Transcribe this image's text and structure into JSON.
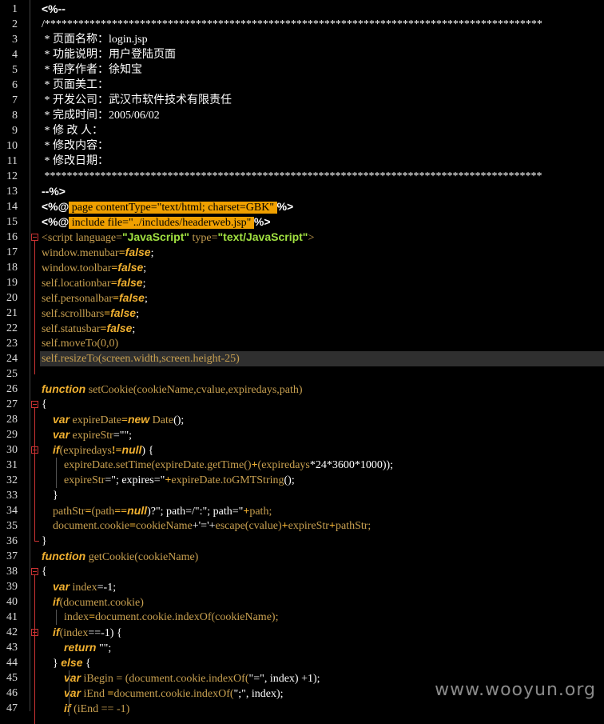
{
  "editor": {
    "lines": [
      [
        {
          "t": "<%--",
          "c": "w"
        }
      ],
      [
        {
          "t": "/*****************************************************************************************",
          "c": "wt"
        }
      ],
      [
        {
          "t": " * 页面名称：login.jsp",
          "c": "wt"
        }
      ],
      [
        {
          "t": " * 功能说明：用户登陆页面",
          "c": "wt"
        }
      ],
      [
        {
          "t": " * 程序作者：徐知宝",
          "c": "wt"
        }
      ],
      [
        {
          "t": " * 页面美工：",
          "c": "wt"
        }
      ],
      [
        {
          "t": " * 开发公司：武汉市软件技术有限责任",
          "c": "wt"
        }
      ],
      [
        {
          "t": " * 完成时间：2005/06/02",
          "c": "wt"
        }
      ],
      [
        {
          "t": " * 修 改 人：",
          "c": "wt"
        }
      ],
      [
        {
          "t": " * 修改内容：",
          "c": "wt"
        }
      ],
      [
        {
          "t": " * 修改日期：",
          "c": "wt"
        }
      ],
      [
        {
          "t": " *****************************************************************************************",
          "c": "wt"
        }
      ],
      [
        {
          "t": "--%>",
          "c": "w"
        }
      ],
      [
        {
          "t": "<%@",
          "c": "w"
        },
        {
          "t": " page contentType=\"text/html; charset=GBK\" ",
          "c": "sel"
        },
        {
          "t": "%>",
          "c": "w"
        }
      ],
      [
        {
          "t": "<%@",
          "c": "w"
        },
        {
          "t": " include file=\"../includes/headerweb.jsp\" ",
          "c": "sel"
        },
        {
          "t": "%>",
          "c": "w"
        }
      ],
      [
        {
          "t": "<script language=",
          "c": "tag"
        },
        {
          "t": "\"JavaScript\"",
          "c": "str"
        },
        {
          "t": " type=",
          "c": "tag"
        },
        {
          "t": "\"text/JavaScript\"",
          "c": "str"
        },
        {
          "t": ">",
          "c": "tag"
        }
      ],
      [
        {
          "t": "window.menubar",
          "c": "id"
        },
        {
          "t": "=",
          "c": "op"
        },
        {
          "t": "false",
          "c": "kw"
        },
        {
          "t": ";",
          "c": "p"
        }
      ],
      [
        {
          "t": "window.toolbar",
          "c": "id"
        },
        {
          "t": "=",
          "c": "op"
        },
        {
          "t": "false",
          "c": "kw"
        },
        {
          "t": ";",
          "c": "p"
        }
      ],
      [
        {
          "t": "self.locationbar",
          "c": "id"
        },
        {
          "t": "=",
          "c": "op"
        },
        {
          "t": "false",
          "c": "kw"
        },
        {
          "t": ";",
          "c": "p"
        }
      ],
      [
        {
          "t": "self.personalbar",
          "c": "id"
        },
        {
          "t": "=",
          "c": "op"
        },
        {
          "t": "false",
          "c": "kw"
        },
        {
          "t": ";",
          "c": "p"
        }
      ],
      [
        {
          "t": "self.scrollbars",
          "c": "id"
        },
        {
          "t": "=",
          "c": "op"
        },
        {
          "t": "false",
          "c": "kw"
        },
        {
          "t": ";",
          "c": "p"
        }
      ],
      [
        {
          "t": "self.statusbar",
          "c": "id"
        },
        {
          "t": "=",
          "c": "op"
        },
        {
          "t": "false",
          "c": "kw"
        },
        {
          "t": ";",
          "c": "p"
        }
      ],
      [
        {
          "t": "self.moveTo(0,0)",
          "c": "id"
        }
      ],
      [
        {
          "t": "self.resizeTo(screen.width,screen.height-25)",
          "c": "id"
        }
      ],
      [],
      [
        {
          "t": "function",
          "c": "kw"
        },
        {
          "t": " setCookie(cookieName,cvalue,expiredays,path)",
          "c": "id"
        }
      ],
      [
        {
          "t": "{",
          "c": "p"
        }
      ],
      [
        {
          "t": "    ",
          "c": "id"
        },
        {
          "t": "var",
          "c": "kw"
        },
        {
          "t": " expireDate",
          "c": "id"
        },
        {
          "t": "=",
          "c": "op"
        },
        {
          "t": "new",
          "c": "kw"
        },
        {
          "t": " Date",
          "c": "id"
        },
        {
          "t": "();",
          "c": "p"
        }
      ],
      [
        {
          "t": "    ",
          "c": "id"
        },
        {
          "t": "var",
          "c": "kw"
        },
        {
          "t": " expireStr",
          "c": "id"
        },
        {
          "t": "=\"\";",
          "c": "p"
        }
      ],
      [
        {
          "t": "    ",
          "c": "id"
        },
        {
          "t": "if",
          "c": "kw"
        },
        {
          "t": "(expiredays",
          "c": "id"
        },
        {
          "t": "!=",
          "c": "op"
        },
        {
          "t": "null",
          "c": "kw"
        },
        {
          "t": ") {",
          "c": "p"
        }
      ],
      [
        {
          "t": "        expireDate.setTime(expireDate.getTime()",
          "c": "id"
        },
        {
          "t": "+",
          "c": "op"
        },
        {
          "t": "(expiredays",
          "c": "id"
        },
        {
          "t": "*24*3600*1000));",
          "c": "p"
        }
      ],
      [
        {
          "t": "        expireStr",
          "c": "id"
        },
        {
          "t": "=\"; expires=\"",
          "c": "p"
        },
        {
          "t": "+",
          "c": "op"
        },
        {
          "t": "expireDate.toGMTString",
          "c": "id"
        },
        {
          "t": "();",
          "c": "p"
        }
      ],
      [
        {
          "t": "    }",
          "c": "p"
        }
      ],
      [
        {
          "t": "    pathStr",
          "c": "id"
        },
        {
          "t": "=",
          "c": "op"
        },
        {
          "t": "(path",
          "c": "id"
        },
        {
          "t": "==",
          "c": "op"
        },
        {
          "t": "null",
          "c": "kw"
        },
        {
          "t": ")?\"; path=/\":\"; path=\"",
          "c": "p"
        },
        {
          "t": "+",
          "c": "op"
        },
        {
          "t": "path;",
          "c": "id"
        }
      ],
      [
        {
          "t": "    document.cookie",
          "c": "id"
        },
        {
          "t": "=",
          "c": "op"
        },
        {
          "t": "cookieName",
          "c": "id"
        },
        {
          "t": "+'='+",
          "c": "p"
        },
        {
          "t": "escape(cvalue)",
          "c": "id"
        },
        {
          "t": "+",
          "c": "op"
        },
        {
          "t": "expireStr",
          "c": "id"
        },
        {
          "t": "+",
          "c": "op"
        },
        {
          "t": "pathStr;",
          "c": "id"
        }
      ],
      [
        {
          "t": "}",
          "c": "p"
        }
      ],
      [
        {
          "t": "function",
          "c": "kw"
        },
        {
          "t": " getCookie(cookieName)",
          "c": "id"
        }
      ],
      [
        {
          "t": "{",
          "c": "p"
        }
      ],
      [
        {
          "t": "    ",
          "c": "id"
        },
        {
          "t": "var",
          "c": "kw"
        },
        {
          "t": " index",
          "c": "id"
        },
        {
          "t": "=-1;",
          "c": "p"
        }
      ],
      [
        {
          "t": "    ",
          "c": "id"
        },
        {
          "t": "if",
          "c": "kw"
        },
        {
          "t": "(document.cookie)",
          "c": "id"
        }
      ],
      [
        {
          "t": "        index",
          "c": "id"
        },
        {
          "t": "=",
          "c": "op"
        },
        {
          "t": "document.cookie.indexOf(cookieName);",
          "c": "id"
        }
      ],
      [
        {
          "t": "    ",
          "c": "id"
        },
        {
          "t": "if",
          "c": "kw"
        },
        {
          "t": "(index",
          "c": "id"
        },
        {
          "t": "==-1) {",
          "c": "p"
        }
      ],
      [
        {
          "t": "        ",
          "c": "id"
        },
        {
          "t": "return",
          "c": "kw"
        },
        {
          "t": " \"\";",
          "c": "p"
        }
      ],
      [
        {
          "t": "    } ",
          "c": "p"
        },
        {
          "t": "else",
          "c": "kw"
        },
        {
          "t": " {",
          "c": "p"
        }
      ],
      [
        {
          "t": "        ",
          "c": "id"
        },
        {
          "t": "var",
          "c": "kw"
        },
        {
          "t": " iBegin = ",
          "c": "id"
        },
        {
          "t": "(document.cookie.indexOf(",
          "c": "id"
        },
        {
          "t": "\"=\", index) +1);",
          "c": "p"
        }
      ],
      [
        {
          "t": "        ",
          "c": "id"
        },
        {
          "t": "var",
          "c": "kw"
        },
        {
          "t": " iEnd ",
          "c": "id"
        },
        {
          "t": "=",
          "c": "op"
        },
        {
          "t": "document.cookie.indexOf(",
          "c": "id"
        },
        {
          "t": "\";\", index);",
          "c": "p"
        }
      ],
      [
        {
          "t": "        ",
          "c": "id"
        },
        {
          "t": "if",
          "c": "kw"
        },
        {
          "t": " (iEnd == -1)",
          "c": "id"
        }
      ]
    ],
    "fold_lines": [
      16,
      27,
      30,
      38,
      42
    ],
    "current_line": 24
  },
  "watermark": "www.wooyun.org"
}
